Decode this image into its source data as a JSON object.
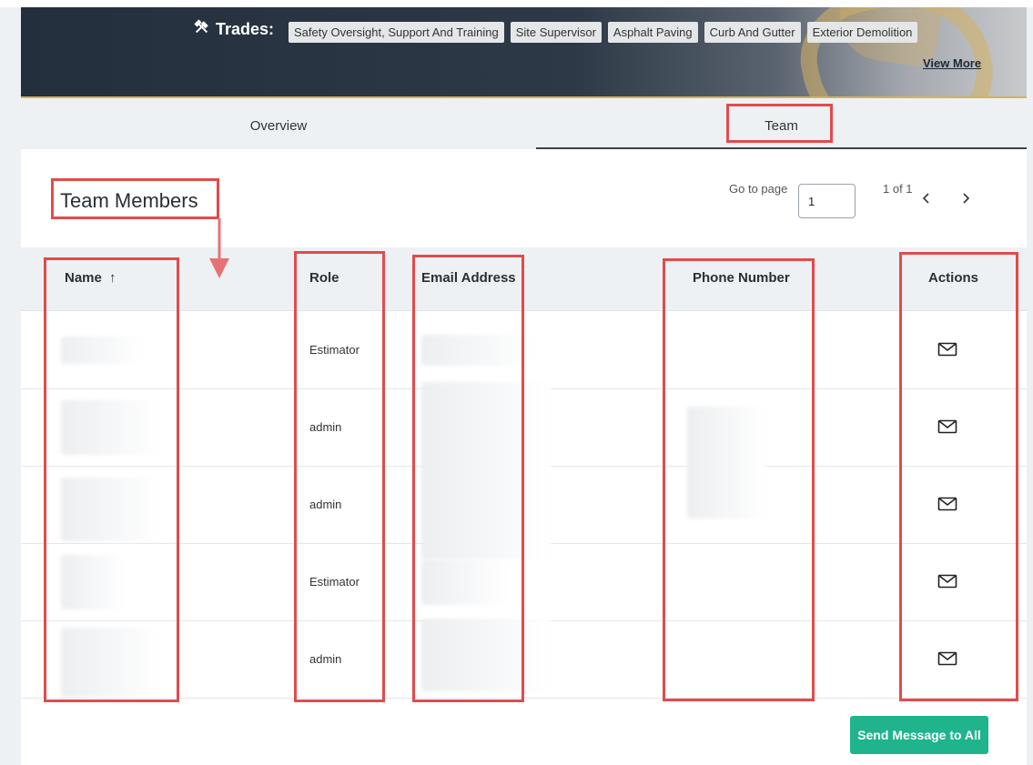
{
  "banner": {
    "trades_label": "Trades:",
    "trades": [
      "Safety Oversight, Support And Training",
      "Site Supervisor",
      "Asphalt Paving",
      "Curb And Gutter",
      "Exterior Demolition"
    ],
    "view_more": "View More"
  },
  "tabs": {
    "overview": "Overview",
    "team": "Team",
    "active": "Team"
  },
  "team": {
    "title": "Team Members",
    "pager": {
      "go_to_label": "Go to page",
      "page_value": "1",
      "count": "1 of 1"
    },
    "columns": {
      "name": "Name",
      "sort_indicator": "↑",
      "role": "Role",
      "email": "Email Address",
      "phone": "Phone Number",
      "actions": "Actions"
    },
    "rows": [
      {
        "role": "Estimator"
      },
      {
        "role": "admin"
      },
      {
        "role": "admin"
      },
      {
        "role": "Estimator"
      },
      {
        "role": "admin"
      }
    ],
    "send_all": "Send Message to All"
  },
  "colors": {
    "accent_green": "#1fb48c",
    "highlight_red": "#e24b4b",
    "banner_dark": "#232f3d",
    "banner_gold": "#d8b15a"
  },
  "icons": {
    "trades": "tools-icon",
    "prev": "chevron-left-icon",
    "next": "chevron-right-icon",
    "action": "mail-icon"
  }
}
